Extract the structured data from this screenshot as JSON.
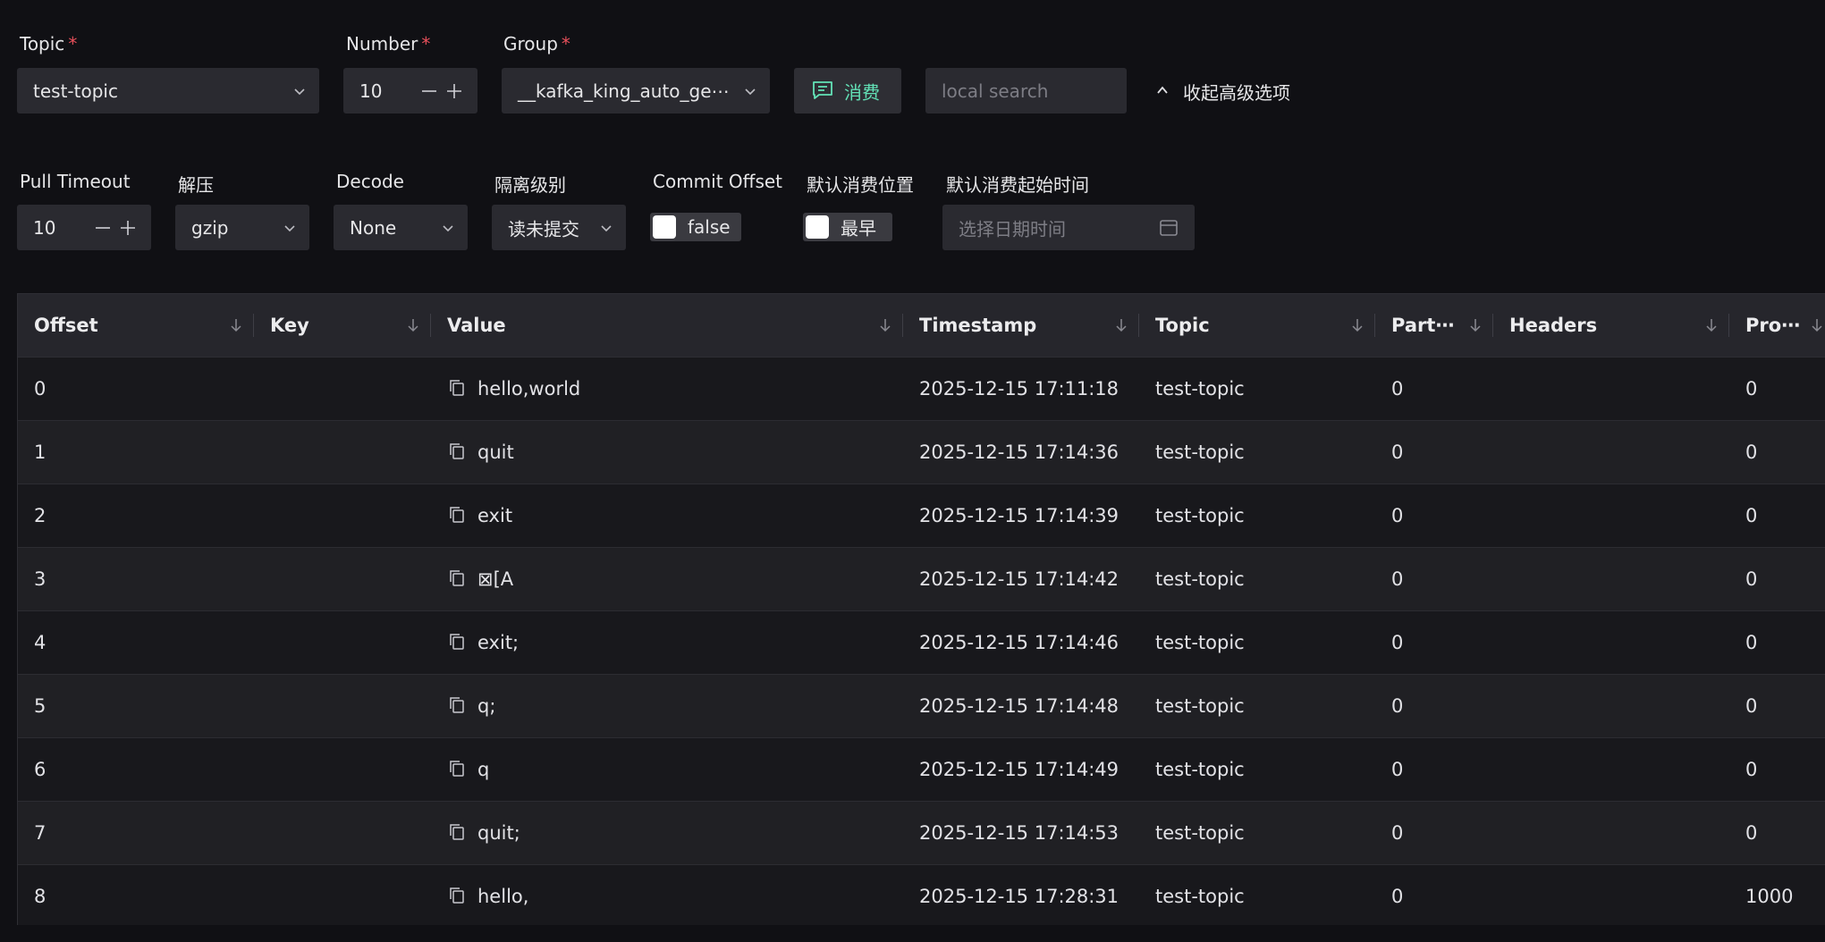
{
  "form": {
    "topic": {
      "label": "Topic",
      "required": "*",
      "value": "test-topic"
    },
    "number": {
      "label": "Number",
      "required": "*",
      "value": "10"
    },
    "group": {
      "label": "Group",
      "required": "*",
      "value": "__kafka_king_auto_ge⋯"
    },
    "consume_button": "消费",
    "local_search": {
      "placeholder": "local search"
    },
    "collapse_advanced": "收起高级选项",
    "pull_timeout": {
      "label": "Pull Timeout",
      "value": "10"
    },
    "decompress": {
      "label": "解压",
      "value": "gzip"
    },
    "decode": {
      "label": "Decode",
      "value": "None"
    },
    "isolation": {
      "label": "隔离级别",
      "value": "读未提交"
    },
    "commit_offset": {
      "label": "Commit Offset",
      "value": "false",
      "checked": false
    },
    "default_position": {
      "label": "默认消费位置",
      "value": "最早",
      "checked": false
    },
    "default_start_time": {
      "label": "默认消费起始时间",
      "placeholder": "选择日期时间"
    }
  },
  "colors": {
    "accent": "#63e2b7",
    "required": "#e8505b"
  },
  "table": {
    "columns": [
      "Offset",
      "Key",
      "Value",
      "Timestamp",
      "Topic",
      "Part⋯",
      "Headers",
      "Pro⋯"
    ],
    "rows": [
      {
        "offset": "0",
        "key": "",
        "value": "hello,world",
        "timestamp": "2025-12-15 17:11:18",
        "topic": "test-topic",
        "partition": "0",
        "headers": "",
        "pro": "0"
      },
      {
        "offset": "1",
        "key": "",
        "value": "quit",
        "timestamp": "2025-12-15 17:14:36",
        "topic": "test-topic",
        "partition": "0",
        "headers": "",
        "pro": "0"
      },
      {
        "offset": "2",
        "key": "",
        "value": "exit",
        "timestamp": "2025-12-15 17:14:39",
        "topic": "test-topic",
        "partition": "0",
        "headers": "",
        "pro": "0"
      },
      {
        "offset": "3",
        "key": "",
        "value": "⊠[A",
        "timestamp": "2025-12-15 17:14:42",
        "topic": "test-topic",
        "partition": "0",
        "headers": "",
        "pro": "0"
      },
      {
        "offset": "4",
        "key": "",
        "value": "exit;",
        "timestamp": "2025-12-15 17:14:46",
        "topic": "test-topic",
        "partition": "0",
        "headers": "",
        "pro": "0"
      },
      {
        "offset": "5",
        "key": "",
        "value": "q;",
        "timestamp": "2025-12-15 17:14:48",
        "topic": "test-topic",
        "partition": "0",
        "headers": "",
        "pro": "0"
      },
      {
        "offset": "6",
        "key": "",
        "value": "q",
        "timestamp": "2025-12-15 17:14:49",
        "topic": "test-topic",
        "partition": "0",
        "headers": "",
        "pro": "0"
      },
      {
        "offset": "7",
        "key": "",
        "value": "quit;",
        "timestamp": "2025-12-15 17:14:53",
        "topic": "test-topic",
        "partition": "0",
        "headers": "",
        "pro": "0"
      },
      {
        "offset": "8",
        "key": "",
        "value": "hello,",
        "timestamp": "2025-12-15 17:28:31",
        "topic": "test-topic",
        "partition": "0",
        "headers": "",
        "pro": "1000"
      }
    ]
  }
}
